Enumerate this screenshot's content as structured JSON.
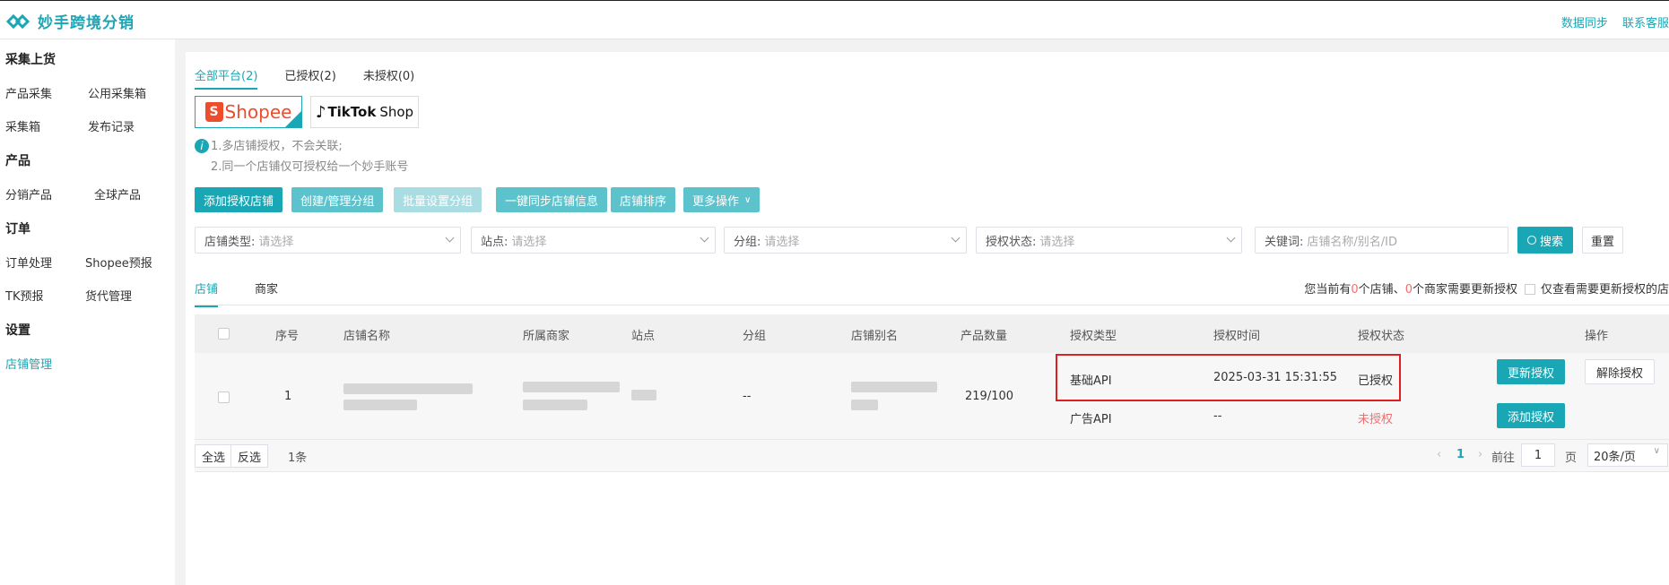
{
  "header": {
    "brand": "妙手跨境分销",
    "links": [
      "数据同步",
      "联系客服"
    ]
  },
  "sidebar": {
    "groups": [
      {
        "title": "采集上货",
        "items": [
          "产品采集",
          "公用采集箱",
          "采集箱",
          "发布记录"
        ]
      },
      {
        "title": "产品",
        "items": [
          "分销产品",
          "全球产品"
        ]
      },
      {
        "title": "订单",
        "items": [
          "订单处理",
          "Shopee预报",
          "TK预报",
          "货代管理"
        ]
      },
      {
        "title": "设置",
        "items": [
          "店铺管理"
        ]
      }
    ],
    "active": "店铺管理"
  },
  "platform_tabs": [
    "全部平台(2)",
    "已授权(2)",
    "未授权(0)"
  ],
  "platforms": {
    "shopee": "Shopee",
    "tiktok": "TikTok",
    "tiktok_suffix": "Shop"
  },
  "tips": [
    "1.多店铺授权，不会关联;",
    "2.同一个店铺仅可授权给一个妙手账号"
  ],
  "actions": [
    "添加授权店铺",
    "创建/管理分组",
    "批量设置分组",
    "一键同步店铺信息",
    "店铺排序",
    "更多操作"
  ],
  "filters": [
    {
      "label": "店铺类型:",
      "placeholder": "请选择"
    },
    {
      "label": "站点:",
      "placeholder": "请选择"
    },
    {
      "label": "分组:",
      "placeholder": "请选择"
    },
    {
      "label": "授权状态:",
      "placeholder": "请选择"
    },
    {
      "label": "关键词:",
      "placeholder": "店铺名称/别名/ID"
    }
  ],
  "search_label": "搜索",
  "reset_label": "重置",
  "sub_tabs": [
    "店铺",
    "商家"
  ],
  "update_note": {
    "p1": "您当前有",
    "shops": "0",
    "p2": "个店铺、",
    "merchants": "0",
    "p3": "个商家需要更新授权",
    "checkbox_label": "仅查看需要更新授权的店"
  },
  "table": {
    "columns": [
      "序号",
      "店铺名称",
      "所属商家",
      "站点",
      "分组",
      "店铺别名",
      "产品数量",
      "授权类型",
      "授权时间",
      "授权状态",
      "操作"
    ],
    "row": {
      "index": "1",
      "group": "--",
      "product_count": "219/100",
      "auth": [
        {
          "type": "基础API",
          "time": "2025-03-31 15:31:55",
          "status": "已授权",
          "actions": [
            "更新授权",
            "解除授权"
          ]
        },
        {
          "type": "广告API",
          "time": "--",
          "status": "未授权",
          "actions": [
            "添加授权"
          ]
        }
      ]
    }
  },
  "footer": {
    "select_all": "全选",
    "invert": "反选",
    "count": "1条",
    "page": "1",
    "goto": "前往",
    "page_input": "1",
    "page_unit": "页",
    "page_size": "20条/页"
  }
}
